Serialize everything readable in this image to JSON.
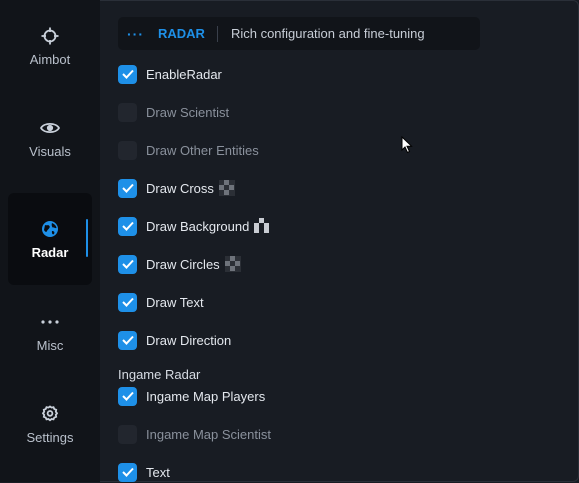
{
  "sidebar": {
    "items": [
      {
        "label": "Aimbot",
        "icon": "crosshair-icon",
        "active": false
      },
      {
        "label": "Visuals",
        "icon": "eye-icon",
        "active": false
      },
      {
        "label": "Radar",
        "icon": "globe-icon",
        "active": true
      },
      {
        "label": "Misc",
        "icon": "more-dots-icon",
        "active": false
      },
      {
        "label": "Settings",
        "icon": "gear-icon",
        "active": false
      }
    ]
  },
  "header": {
    "dots": "···",
    "title": "RADAR",
    "subtitle": "Rich configuration and fine-tuning"
  },
  "options": [
    {
      "label": "EnableRadar",
      "checked": true
    },
    {
      "label": "Draw Scientist",
      "checked": false
    },
    {
      "label": "Draw Other Entities",
      "checked": false
    },
    {
      "label": "Draw Cross",
      "checked": true,
      "color_picker": true
    },
    {
      "label": "Draw Background",
      "checked": true,
      "color_picker": true
    },
    {
      "label": "Draw Circles",
      "checked": true,
      "color_picker": true
    },
    {
      "label": "Draw Text",
      "checked": true
    },
    {
      "label": "Draw Direction",
      "checked": true
    }
  ],
  "ingame_section": {
    "label": "Ingame Radar",
    "options": [
      {
        "label": "Ingame Map Players",
        "checked": true
      },
      {
        "label": "Ingame Map Scientist",
        "checked": false
      },
      {
        "label": "Text",
        "checked": true
      }
    ]
  },
  "colors": {
    "accent": "#1e90e8",
    "background": "#181c23",
    "sidebar": "#111419"
  }
}
